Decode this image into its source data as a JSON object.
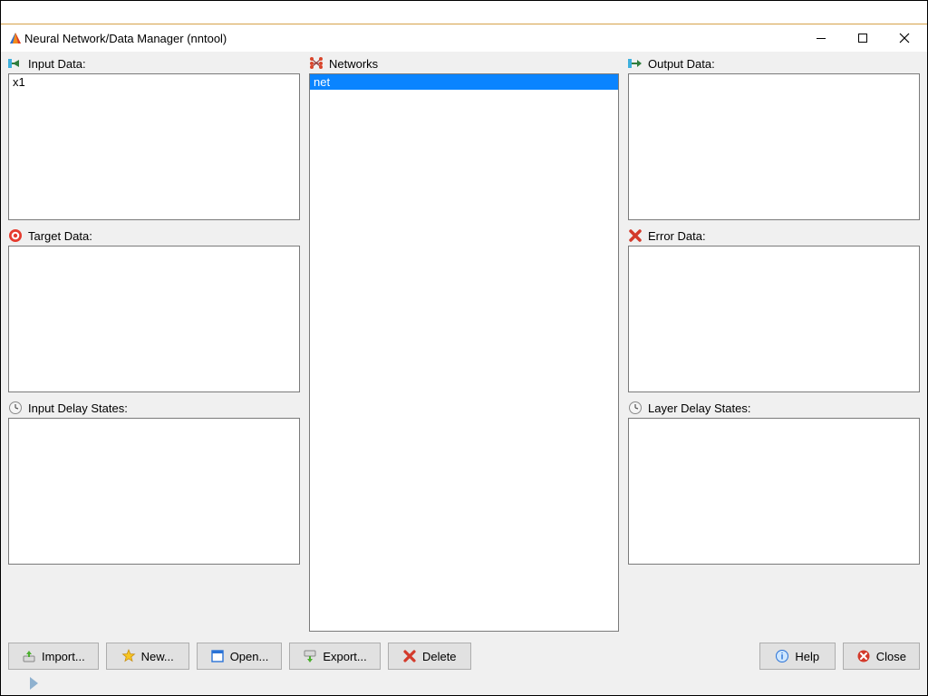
{
  "window": {
    "title": "Neural Network/Data Manager (nntool)"
  },
  "panels": {
    "input_data": {
      "label": "Input Data:",
      "items": [
        "x1"
      ]
    },
    "target_data": {
      "label": "Target Data:",
      "items": []
    },
    "input_delay": {
      "label": "Input Delay States:",
      "items": []
    },
    "networks": {
      "label": "Networks",
      "items": [
        "net"
      ],
      "selected": "net"
    },
    "output_data": {
      "label": "Output Data:",
      "items": []
    },
    "error_data": {
      "label": "Error Data:",
      "items": []
    },
    "layer_delay": {
      "label": "Layer Delay States:",
      "items": []
    }
  },
  "buttons": {
    "import": "Import...",
    "new": "New...",
    "open": "Open...",
    "export": "Export...",
    "delete": "Delete",
    "help": "Help",
    "close": "Close"
  }
}
